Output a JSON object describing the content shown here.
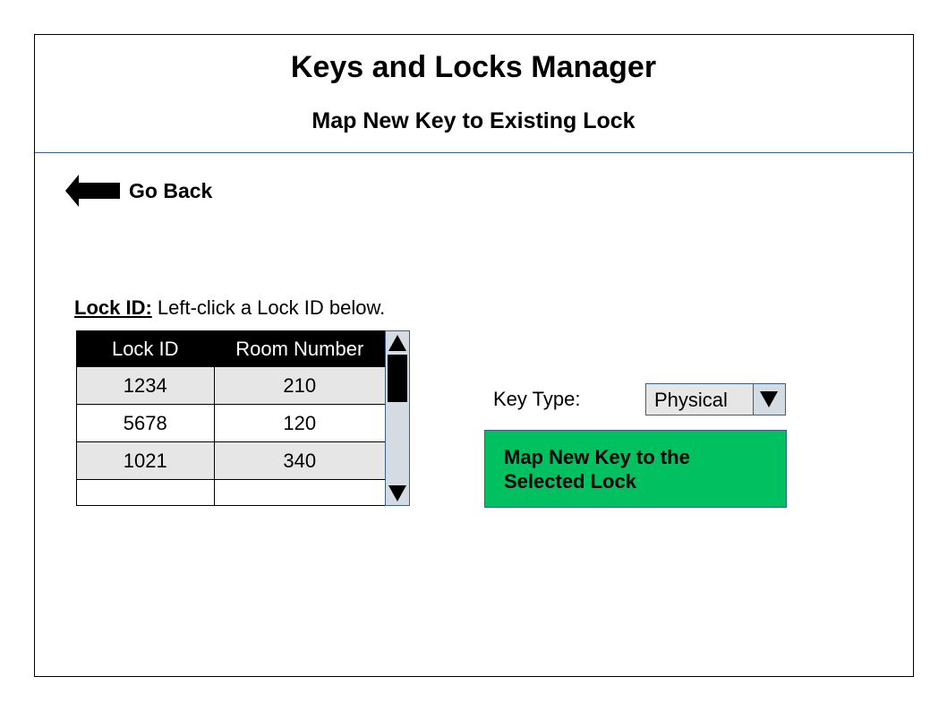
{
  "header": {
    "title": "Keys and Locks Manager",
    "subtitle": "Map New Key to Existing Lock"
  },
  "nav": {
    "go_back_label": "Go Back",
    "go_back_icon": "left-arrow-icon"
  },
  "lock_table": {
    "label_bold": "Lock ID:",
    "label_hint": " Left-click a Lock ID below.",
    "columns": [
      "Lock ID",
      "Room Number"
    ],
    "rows": [
      [
        "1234",
        "210"
      ],
      [
        "5678",
        "120"
      ],
      [
        "1021",
        "340"
      ],
      [
        "",
        ""
      ]
    ]
  },
  "key_type": {
    "label": "Key Type:",
    "selected": "Physical"
  },
  "actions": {
    "map_button_label": "Map New Key to the Selected Lock"
  },
  "colors": {
    "accent_green": "#00c060",
    "border_blue": "#3b5f86",
    "row_gray": "#e6e6e6"
  }
}
